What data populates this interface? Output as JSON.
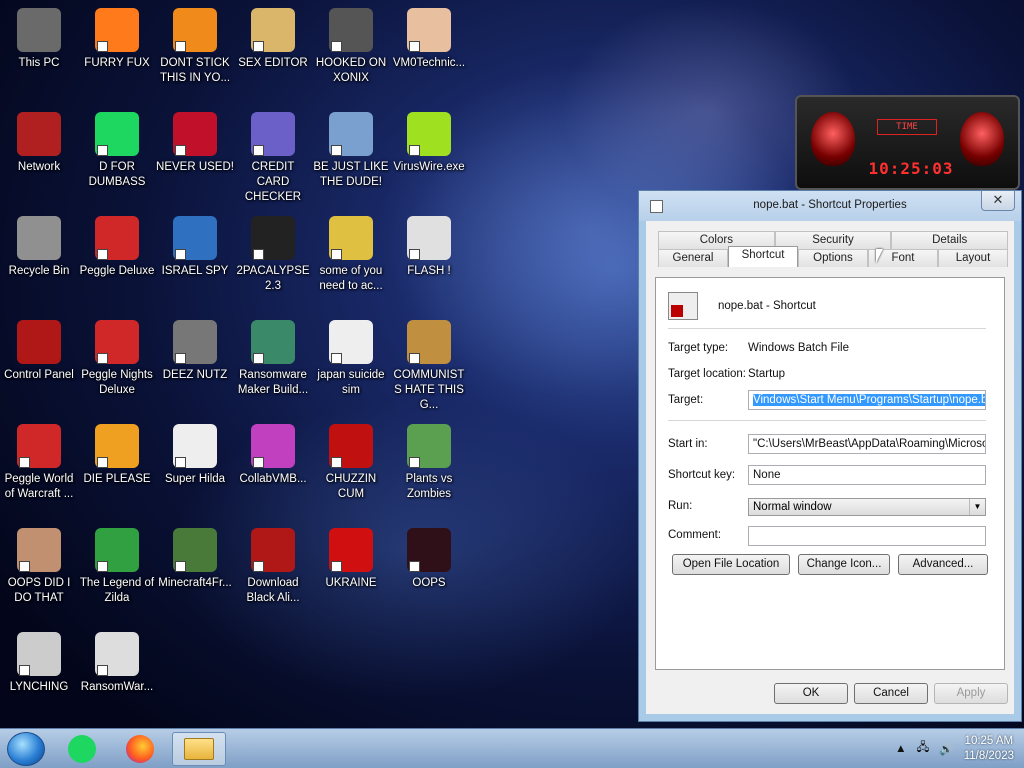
{
  "desktop_icons": [
    {
      "label": "This PC",
      "icon": "computer-icon"
    },
    {
      "label": "FURRY FUX",
      "icon": "firefox-icon"
    },
    {
      "label": "DONT STICK THIS IN YO...",
      "icon": "vlc-cone-icon"
    },
    {
      "label": "SEX EDITOR",
      "icon": "hxd-icon"
    },
    {
      "label": "HOOKED ON XONIX",
      "icon": "xonix-icon"
    },
    {
      "label": "VM0Technic...",
      "icon": "doctor-icon"
    },
    {
      "label": "Network",
      "icon": "alien-icon"
    },
    {
      "label": "D FOR DUMBASS",
      "icon": "spotify-icon"
    },
    {
      "label": "NEVER USED!",
      "icon": "devcpp-icon"
    },
    {
      "label": "CREDIT CARD CHECKER",
      "icon": "credit-card-icon"
    },
    {
      "label": "BE JUST LIKE THE DUDE!",
      "icon": "dwarf-icon"
    },
    {
      "label": "VirusWire.exe",
      "icon": "lime-icon"
    },
    {
      "label": "Recycle Bin",
      "icon": "recycle-bin-icon"
    },
    {
      "label": "Peggle Deluxe",
      "icon": "peggle-icon"
    },
    {
      "label": "ISRAEL SPY",
      "icon": "network-spy-icon"
    },
    {
      "label": "2PACALYPSE 2.3",
      "icon": "terminal-icon"
    },
    {
      "label": "some of you need to ac...",
      "icon": "beaver-icon"
    },
    {
      "label": "FLASH !",
      "icon": "flash-icon"
    },
    {
      "label": "Control Panel",
      "icon": "control-panel-icon"
    },
    {
      "label": "Peggle Nights Deluxe",
      "icon": "peggle-icon"
    },
    {
      "label": "DEEZ NUTZ",
      "icon": "stack-icon"
    },
    {
      "label": "Ransomware Maker Build...",
      "icon": "window-icon"
    },
    {
      "label": "japan suicide sim",
      "icon": "document-icon"
    },
    {
      "label": "COMMUNISTS HATE THIS G...",
      "icon": "money-bag-icon"
    },
    {
      "label": "Peggle World of Warcraft ...",
      "icon": "peggle-icon"
    },
    {
      "label": "DIE PLEASE",
      "icon": "de-icon"
    },
    {
      "label": "Super Hilda",
      "icon": "pixel-cat-icon"
    },
    {
      "label": "CollabVMB...",
      "icon": "collab-icon"
    },
    {
      "label": "CHUZZIN CUM",
      "icon": "chuzzle-icon"
    },
    {
      "label": "Plants vs Zombies",
      "icon": "flower-icon"
    },
    {
      "label": "OOPS DID I DO THAT",
      "icon": "portrait-icon"
    },
    {
      "label": "The Legend of Zilda",
      "icon": "pixel-hero-icon"
    },
    {
      "label": "Minecraft4Fr...",
      "icon": "grass-block-icon"
    },
    {
      "label": "Download Black Ali...",
      "icon": "alien-icon"
    },
    {
      "label": "UKRAINE",
      "icon": "radiation-icon"
    },
    {
      "label": "OOPS",
      "icon": "dark-app-icon"
    },
    {
      "label": "LYNCHING",
      "icon": "noose-icon"
    },
    {
      "label": "RansomWar...",
      "icon": "skull-icon"
    }
  ],
  "gadget": {
    "label": "TIME",
    "time": "10:25:03"
  },
  "dialog": {
    "title": "nope.bat - Shortcut Properties",
    "close": "✕",
    "tabs_top": [
      "Colors",
      "Security",
      "Details"
    ],
    "tabs_bottom": [
      "General",
      "Shortcut",
      "Options",
      "Font",
      "Layout"
    ],
    "active_tab": "Shortcut",
    "name": "nope.bat - Shortcut",
    "target_type_label": "Target type:",
    "target_type": "Windows Batch File",
    "target_location_label": "Target location:",
    "target_location": "Startup",
    "target_label": "Target:",
    "target": "Vindows\\Start Menu\\Programs\\Startup\\nope.bat\"",
    "start_in_label": "Start in:",
    "start_in": "\"C:\\Users\\MrBeast\\AppData\\Roaming\\Microsoft\\",
    "shortcut_key_label": "Shortcut key:",
    "shortcut_key": "None",
    "run_label": "Run:",
    "run": "Normal window",
    "comment_label": "Comment:",
    "comment": "",
    "btn_open": "Open File Location",
    "btn_change_icon": "Change Icon...",
    "btn_advanced": "Advanced...",
    "btn_ok": "OK",
    "btn_cancel": "Cancel",
    "btn_apply": "Apply"
  },
  "taskbar": {
    "time": "10:25 AM",
    "date": "11/8/2023"
  },
  "colors": {
    "accent": "#3399ff",
    "taskbar": "#9db8dc"
  }
}
